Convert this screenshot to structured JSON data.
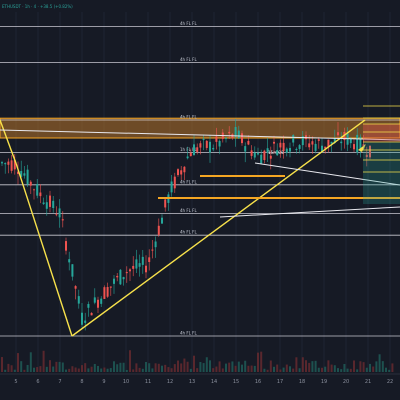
{
  "header": {
    "symbol_line": "ETHUSDT · 1h · 4 · +38.5 (+0.82%)",
    "symbol_color": "#2aa198"
  },
  "colors": {
    "background": "#161a25",
    "level_line": "#e8e8ee",
    "up_candle": "#26a69a",
    "down_candle": "#ef5350",
    "supply_zone": "#b8742a",
    "supply_zone_border": "#f5a623",
    "trend_line": "#f7e14b",
    "trendline_white": "#e8e8ee"
  },
  "levels": [
    {
      "label": "4h FL FL",
      "price": 96
    },
    {
      "label": "4h FL FL",
      "price": 86
    },
    {
      "label": "4h FL FL",
      "price": 70
    },
    {
      "label": "1h FL FL",
      "price": 61
    },
    {
      "label": "4h FL FL",
      "price": 52
    },
    {
      "label": "4h FL FL",
      "price": 44
    },
    {
      "label": "4h FL FL",
      "price": 38
    },
    {
      "label": "4h FL FL",
      "price": 10
    }
  ],
  "zone": {
    "label": "15m OB",
    "low": 65,
    "high": 70.5
  },
  "x_axis_ticks": [
    "5",
    "6",
    "7",
    "8",
    "9",
    "10",
    "11",
    "12",
    "13",
    "14",
    "15",
    "16",
    "17",
    "18",
    "19",
    "20",
    "21",
    "22"
  ],
  "chart_data": {
    "type": "line",
    "title": "",
    "xlabel": "",
    "ylabel": "",
    "x": [
      "5",
      "6",
      "7",
      "8",
      "9",
      "10",
      "11",
      "12",
      "13",
      "14",
      "15",
      "16",
      "17",
      "18",
      "19",
      "20",
      "21",
      "22"
    ],
    "ylim": [
      0,
      100
    ],
    "series": [
      {
        "values": [
          58,
          50,
          44,
          15,
          22,
          28,
          30,
          50,
          62,
          63,
          66,
          60,
          63,
          64,
          63,
          65,
          62,
          63
        ]
      }
    ]
  }
}
